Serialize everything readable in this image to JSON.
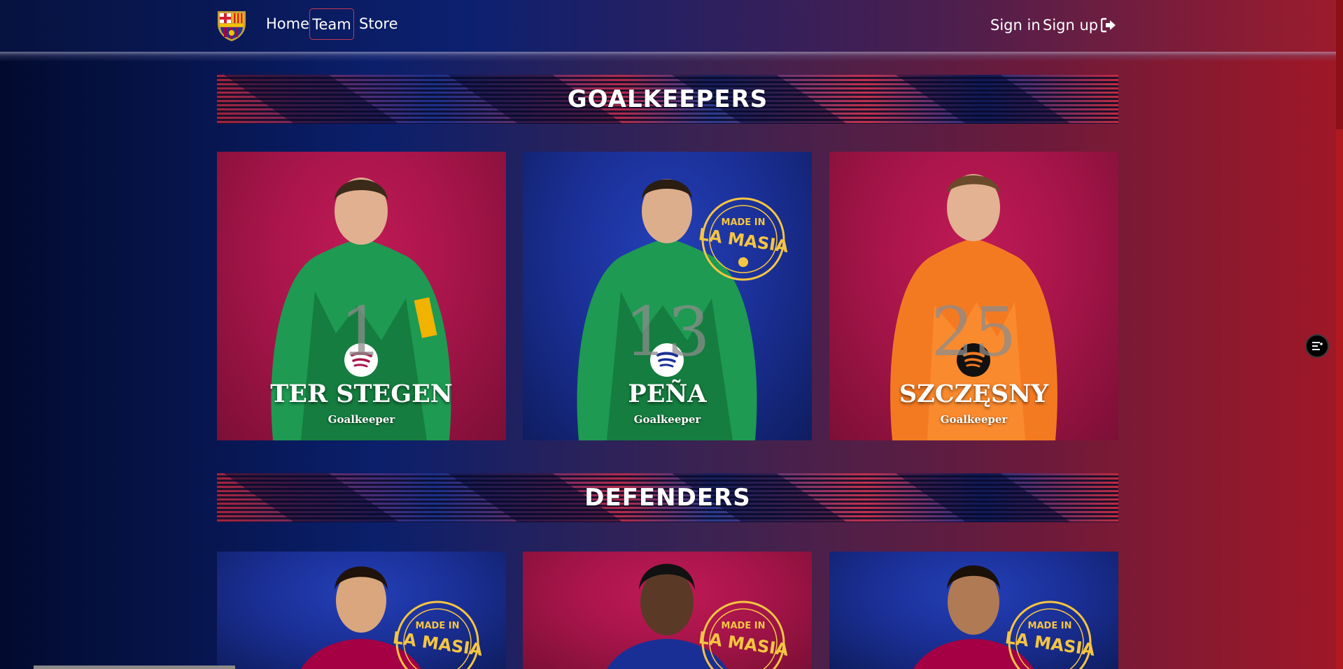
{
  "navbar": {
    "logo_alt": "FC Barcelona crest",
    "links": {
      "home": "Home",
      "team": "Team",
      "store": "Store"
    },
    "auth": {
      "sign_in": "Sign in",
      "sign_up": "Sign up",
      "signout_icon": "sign-out-icon"
    },
    "active_link": "Team"
  },
  "sections": {
    "goalkeepers": {
      "title": "GOALKEEPERS",
      "players": [
        {
          "number": "1",
          "name": "TER STEGEN",
          "position": "Goalkeeper",
          "background": "red",
          "kit": "green"
        },
        {
          "number": "13",
          "name": "PEÑA",
          "position": "Goalkeeper",
          "background": "blue",
          "kit": "green",
          "masia_badge": true
        },
        {
          "number": "25",
          "name": "SZCZĘSNY",
          "position": "Goalkeeper",
          "background": "red",
          "kit": "orange"
        }
      ]
    },
    "defenders": {
      "title": "DEFENDERS",
      "players": [
        {
          "background": "blue",
          "masia_badge": true
        },
        {
          "background": "red",
          "masia_badge": true
        },
        {
          "background": "blue",
          "masia_badge": true
        }
      ]
    }
  },
  "masia_badge": {
    "line1": "MADE IN",
    "line2": "LA MASIA"
  },
  "colors": {
    "accent_red": "#a50044",
    "accent_blue": "#004d98",
    "badge_yellow": "#f5c542"
  },
  "widget_icon": "list-menu-icon"
}
